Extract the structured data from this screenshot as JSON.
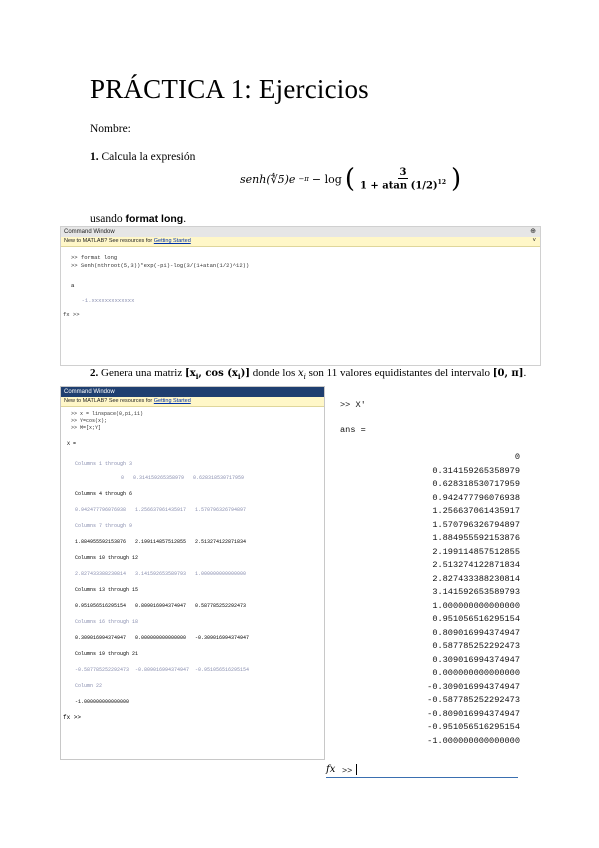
{
  "title": "PRÁCTICA 1: Ejercicios",
  "nombre_label": "Nombre:",
  "ex1": {
    "number": "1.",
    "text": "Calcula la expresión",
    "formula_left": "senh(∜5)e",
    "formula_exp": "−π",
    "formula_minus_log": "− log",
    "frac_num": "3",
    "frac_den": "1 + atan (1/2)",
    "frac_den_exp": "12",
    "after_text": "usando",
    "after_code": "format long",
    "after_end": "."
  },
  "cw1": {
    "title": "Command Window",
    "banner_text": "New to MATLAB? See resources for",
    "banner_link": "Getting Started",
    "lines": [
      ">> format long",
      ">> Senh(nthroot(5,3))*exp(-pi)-log(3/(1+atan(1/2)^12))",
      "a",
      "  -1.xxxxxxxxxxxxx",
      "fx >>"
    ]
  },
  "ex2": {
    "number": "2.",
    "text_a": "Genera una matriz",
    "matrix": "[x",
    "matrix_sub": "i",
    "matrix_mid": ",  cos (x",
    "matrix_end": ")]",
    "text_b": "donde los",
    "xi": "x",
    "text_c": "son 11 valores equidistantes del intervalo",
    "interval": "[0, π]",
    "end": "."
  },
  "cw2": {
    "title": "Command Window",
    "banner_text": "New to MATLAB? See resources for",
    "banner_link": "Getting Started",
    "cmds": [
      ">> x = linspace(0,pi,11)",
      ">> Y=cos(x);",
      ">> M=[x;Y]"
    ],
    "var": "X =",
    "blocks": [
      {
        "header": "Columns 1 through 3",
        "values": "0   0.314159265358979   0.628318530717959"
      },
      {
        "header": "Columns 4 through 6",
        "values": "0.942477796076938   1.256637061435917   1.570796326794897"
      },
      {
        "header": "Columns 7 through 9",
        "values": "1.884955592153876   2.199114857512855   2.513274122871834"
      },
      {
        "header": "Columns 10 through 12",
        "values": "2.827433388230814   3.141592653589793   1.000000000000000"
      },
      {
        "header": "Columns 13 through 15",
        "values": "0.951056516295154   0.809016994374947   0.587785252292473"
      },
      {
        "header": "Columns 16 through 18",
        "values": "0.309016994374947   0.000000000000000   -0.309016994374947"
      },
      {
        "header": "Columns 19 through 21",
        "values": "-0.587785252292473  -0.809016994374947  -0.951056516295154"
      },
      {
        "header": "Column 22",
        "values": "-1.000000000000000"
      }
    ],
    "prompt": "fx >>"
  },
  "right": {
    "cmd": ">> X'",
    "ans": "ans =",
    "values": [
      "0",
      "0.314159265358979",
      "0.628318530717959",
      "0.942477796076938",
      "1.256637061435917",
      "1.570796326794897",
      "1.884955592153876",
      "2.199114857512855",
      "2.513274122871834",
      "2.827433388230814",
      "3.141592653589793",
      "1.000000000000000",
      "0.951056516295154",
      "0.809016994374947",
      "0.587785252292473",
      "0.309016994374947",
      "0.000000000000000",
      "-0.309016994374947",
      "-0.587785252292473",
      "-0.809016994374947",
      "-0.951056516295154",
      "-1.000000000000000"
    ],
    "prompt_fx": "fx",
    "prompt": ">>"
  }
}
